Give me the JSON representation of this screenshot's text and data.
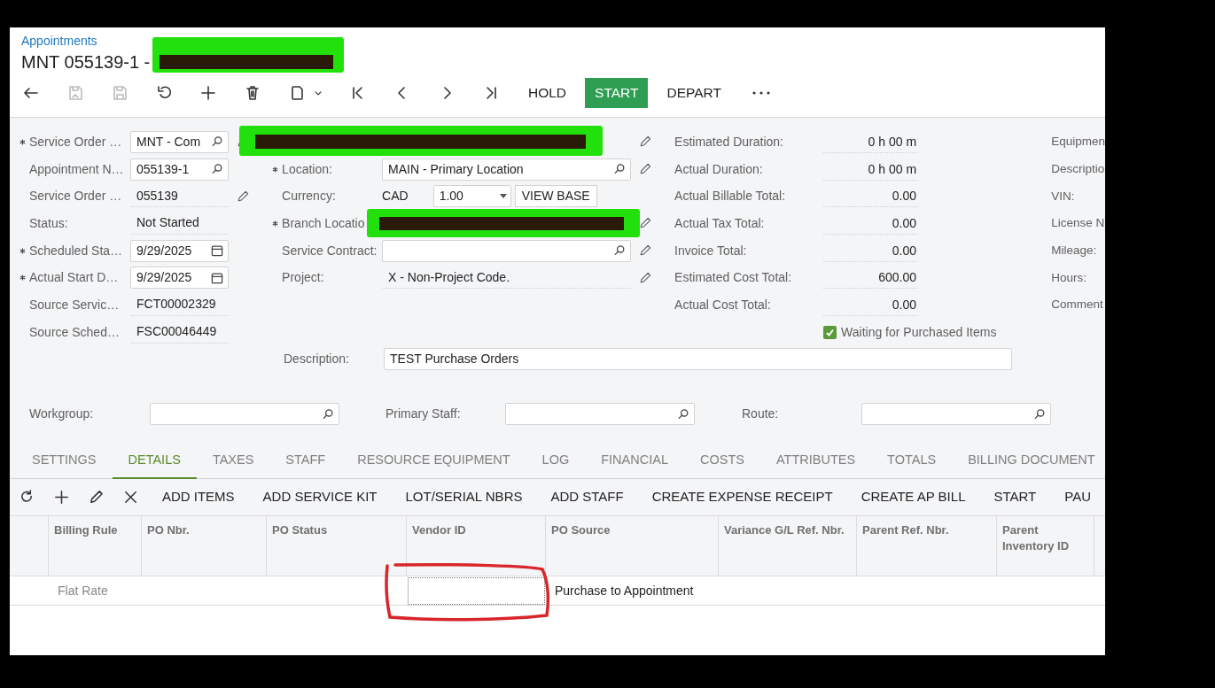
{
  "breadcrumb": "Appointments",
  "title": "MNT 055139-1 -",
  "toolbar": {
    "icons": [
      {
        "disabled": false
      },
      {
        "disabled": true
      },
      {
        "disabled": true
      },
      {
        "disabled": false
      },
      {
        "disabled": false
      },
      {
        "disabled": false
      },
      {
        "disabled": false
      },
      {
        "disabled": false
      },
      {
        "disabled": false
      },
      {
        "disabled": false
      },
      {
        "disabled": false
      }
    ],
    "buttons": [
      {
        "label": "HOLD",
        "primary": false
      },
      {
        "label": "START",
        "primary": true
      },
      {
        "label": "DEPART",
        "primary": false
      }
    ]
  },
  "form": {
    "column_1": [
      {
        "label": "Service Order …",
        "value": "MNT - Com",
        "required": true,
        "kind": "lookup",
        "editable": true
      },
      {
        "label": "Appointment N…",
        "value": "055139-1",
        "required": false,
        "kind": "lookup",
        "editable": false
      },
      {
        "label": "Service Order …",
        "value": "055139",
        "required": false,
        "kind": "text",
        "editable": true
      },
      {
        "label": "Status:",
        "value": "Not Started",
        "required": false,
        "kind": "text",
        "editable": false
      },
      {
        "label": "Scheduled Sta…",
        "value": "9/29/2025",
        "required": true,
        "kind": "date",
        "editable": false
      },
      {
        "label": "Actual Start D…",
        "value": "9/29/2025",
        "required": true,
        "kind": "date",
        "editable": false
      },
      {
        "label": "Source Servic…",
        "value": "FCT00002329",
        "required": false,
        "kind": "text",
        "editable": false
      },
      {
        "label": "Source Sched…",
        "value": "FSC00046449",
        "required": false,
        "kind": "text",
        "editable": false
      }
    ],
    "column_2": [
      {
        "kind": "redacted",
        "editable": true
      },
      {
        "label": "Location:",
        "value": "MAIN - Primary Location",
        "required": true,
        "kind": "lookup",
        "editable": true
      },
      {
        "label": "Currency:",
        "value": "CAD",
        "rate": "1.00",
        "button": "VIEW BASE",
        "required": false,
        "kind": "currency",
        "editable": false
      },
      {
        "label": "Branch Locatio",
        "required": true,
        "kind": "redacted",
        "editable": true
      },
      {
        "label": "Service Contract:",
        "required": false,
        "kind": "lookup",
        "editable": true
      },
      {
        "label": "Project:",
        "value": "X - Non-Project Code.",
        "required": false,
        "kind": "text",
        "editable": true
      }
    ],
    "totals": [
      {
        "label": "Estimated Duration:",
        "value": "0 h 00 m"
      },
      {
        "label": "Actual Duration:",
        "value": "0 h 00 m"
      },
      {
        "label": "Actual Billable Total:",
        "value": "0.00"
      },
      {
        "label": "Actual Tax Total:",
        "value": "0.00"
      },
      {
        "label": "Invoice Total:",
        "value": "0.00"
      },
      {
        "label": "Estimated Cost Total:",
        "value": "600.00"
      },
      {
        "label": "Actual Cost Total:",
        "value": "0.00"
      }
    ],
    "waiting_for_purchased_items": {
      "label": "Waiting for Purchased Items",
      "checked": true
    },
    "column_4": [
      {
        "label": "Equipmen"
      },
      {
        "label": "Descriptio"
      },
      {
        "label": "VIN:"
      },
      {
        "label": "License N"
      },
      {
        "label": "Mileage:"
      },
      {
        "label": "Hours:"
      },
      {
        "label": "Comment"
      }
    ],
    "description": {
      "label": "Description:",
      "value": "TEST Purchase Orders"
    }
  },
  "assignment": [
    {
      "label": "Workgroup:"
    },
    {
      "label": "Primary Staff:"
    },
    {
      "label": "Route:"
    }
  ],
  "tabs": [
    {
      "label": "SETTINGS",
      "selected": false
    },
    {
      "label": "DETAILS",
      "selected": true
    },
    {
      "label": "TAXES",
      "selected": false
    },
    {
      "label": "STAFF",
      "selected": false
    },
    {
      "label": "RESOURCE EQUIPMENT",
      "selected": false
    },
    {
      "label": "LOG",
      "selected": false
    },
    {
      "label": "FINANCIAL",
      "selected": false
    },
    {
      "label": "COSTS",
      "selected": false
    },
    {
      "label": "ATTRIBUTES",
      "selected": false
    },
    {
      "label": "TOTALS",
      "selected": false
    },
    {
      "label": "BILLING DOCUMENT",
      "selected": false
    }
  ],
  "grid_toolbar": {
    "buttons": [
      "ADD ITEMS",
      "ADD SERVICE KIT",
      "LOT/SERIAL NBRS",
      "ADD STAFF",
      "CREATE EXPENSE RECEIPT",
      "CREATE AP BILL",
      "START",
      "PAU"
    ]
  },
  "table": {
    "columns": [
      {
        "label": "Billing Rule"
      },
      {
        "label": "PO Nbr."
      },
      {
        "label": "PO Status"
      },
      {
        "label": "Vendor ID"
      },
      {
        "label": "PO Source"
      },
      {
        "label": "Variance G/L Ref. Nbr."
      },
      {
        "label": "Parent Ref. Nbr."
      },
      {
        "label": "Parent Inventory ID"
      }
    ],
    "rows": [
      {
        "cells": [
          {
            "text": "Flat Rate",
            "muted": true,
            "focused": false
          },
          {
            "focused": false
          },
          {
            "focused": false
          },
          {
            "focused": true
          },
          {
            "text": "Purchase to Appointment",
            "muted": false,
            "focused": false
          },
          {
            "focused": false
          },
          {
            "focused": false
          },
          {
            "focused": false
          }
        ]
      }
    ]
  }
}
